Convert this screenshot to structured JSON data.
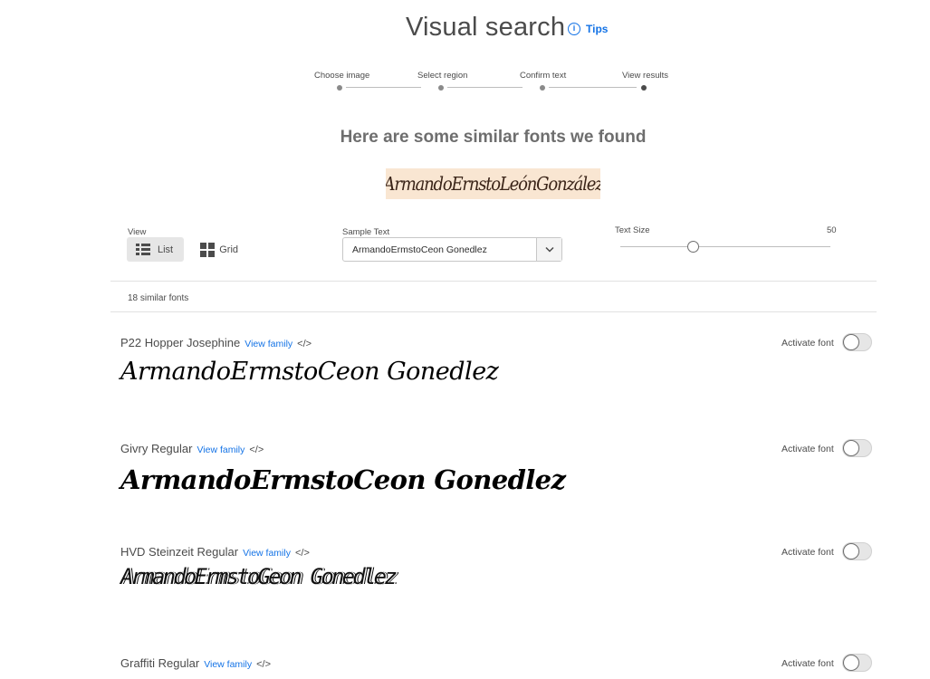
{
  "header": {
    "title": "Visual search",
    "tips_label": "Tips"
  },
  "stepper": {
    "steps": [
      {
        "label": "Choose image"
      },
      {
        "label": "Select region"
      },
      {
        "label": "Confirm text"
      },
      {
        "label": "View results"
      }
    ],
    "active_step": "View results"
  },
  "results": {
    "heading": "Here are some similar fonts we found",
    "sample_image_text": "ArmandoErnstoLeónGonzález"
  },
  "controls": {
    "view_label": "View",
    "list_label": "List",
    "grid_label": "Grid",
    "sample_text_label": "Sample Text",
    "sample_text_value": "ArmandoErmstoCeon Gonedlez",
    "text_size_label": "Text Size",
    "text_size_value": "50"
  },
  "count_label": "18 similar fonts",
  "fonts": [
    {
      "name": "P22 Hopper Josephine",
      "view_family": "View family",
      "code": "</>",
      "activate": "Activate font",
      "sample": "ArmandoErmstoCeon Gonedlez",
      "active": false
    },
    {
      "name": "Givry Regular",
      "view_family": "View family",
      "code": "</>",
      "activate": "Activate font",
      "sample": "ArmandoErmstoCeon Gonedlez",
      "active": false
    },
    {
      "name": "HVD Steinzeit Regular",
      "view_family": "View family",
      "code": "</>",
      "activate": "Activate font",
      "sample": "ArmandoErmstoGeon Gonedlez",
      "active": false
    },
    {
      "name": "Graffiti Regular",
      "view_family": "View family",
      "code": "</>",
      "activate": "Activate font",
      "active": false
    }
  ],
  "colors": {
    "accent": "#1473e6",
    "text": "#4b4b4b"
  }
}
